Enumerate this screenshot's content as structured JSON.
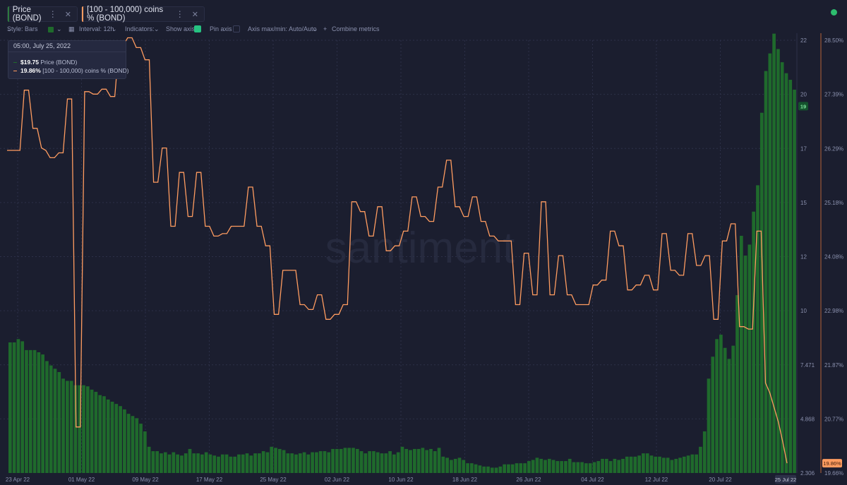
{
  "tabs": [
    {
      "label": "Price (BOND)",
      "color": "#2d7a3e"
    },
    {
      "label": "[100 - 100,000) coins % (BOND)",
      "color": "#ff9c60"
    }
  ],
  "toolbar": {
    "style": "Style: Bars",
    "interval": "Interval: 12h",
    "indicators": "Indicators:",
    "show_axis": "Show axis",
    "pin_axis": "Pin axis",
    "axis_minmax": "Axis max/min: Auto/Auto",
    "combine": "Combine metrics"
  },
  "tooltip": {
    "date": "05:00, July 25, 2022",
    "price_value": "$19.75",
    "price_label": "Price (BOND)",
    "holders_value": "19.86%",
    "holders_label": "[100 - 100,000) coins % (BOND)"
  },
  "watermark": "santiment",
  "colors": {
    "price": "#1f6a2c",
    "holders": "#ff9c60",
    "background": "#1b1e2f",
    "live": "#2dbd6e"
  },
  "chart_data": {
    "type": "bar",
    "x_ticks": [
      "23 Apr 22",
      "01 May 22",
      "09 May 22",
      "17 May 22",
      "25 May 22",
      "02 Jun 22",
      "10 Jun 22",
      "18 Jun 22",
      "26 Jun 22",
      "04 Jul 22",
      "12 Jul 22",
      "20 Jul 22"
    ],
    "last_x_label": "25 Jul 22",
    "price_axis": {
      "ticks": [
        "22",
        "20",
        "17",
        "15",
        "12",
        "10",
        "7.471",
        "4.868",
        "2.306"
      ],
      "ylim": [
        2.306,
        22
      ],
      "current_label": "19"
    },
    "holders_axis": {
      "ticks": [
        "28.50%",
        "27.39%",
        "26.29%",
        "25.18%",
        "24.08%",
        "22.98%",
        "21.87%",
        "20.77%",
        "19.66%"
      ],
      "ylim": [
        19.66,
        28.5
      ],
      "current_label": "19.86%"
    },
    "series": [
      {
        "name": "Price (BOND)",
        "type": "bar",
        "axis": "price",
        "values": [
          8.25,
          8.25,
          8.4,
          8.3,
          7.9,
          7.9,
          7.9,
          7.8,
          7.7,
          7.4,
          7.2,
          7.05,
          6.9,
          6.6,
          6.5,
          6.5,
          6.3,
          6.3,
          6.3,
          6.25,
          6.1,
          6.0,
          5.85,
          5.8,
          5.65,
          5.55,
          5.45,
          5.35,
          5.2,
          5.0,
          4.9,
          4.8,
          4.55,
          4.2,
          3.5,
          3.3,
          3.3,
          3.2,
          3.25,
          3.15,
          3.25,
          3.15,
          3.1,
          3.2,
          3.4,
          3.2,
          3.2,
          3.15,
          3.25,
          3.15,
          3.1,
          3.05,
          3.15,
          3.15,
          3.05,
          3.05,
          3.15,
          3.15,
          3.2,
          3.1,
          3.2,
          3.2,
          3.3,
          3.25,
          3.5,
          3.45,
          3.4,
          3.35,
          3.2,
          3.2,
          3.15,
          3.2,
          3.25,
          3.15,
          3.25,
          3.25,
          3.3,
          3.3,
          3.25,
          3.4,
          3.4,
          3.4,
          3.45,
          3.45,
          3.45,
          3.4,
          3.3,
          3.2,
          3.3,
          3.3,
          3.25,
          3.2,
          3.2,
          3.3,
          3.15,
          3.25,
          3.5,
          3.4,
          3.35,
          3.4,
          3.4,
          3.45,
          3.35,
          3.4,
          3.3,
          3.45,
          3.05,
          3.0,
          2.9,
          2.95,
          3.0,
          2.9,
          2.75,
          2.75,
          2.7,
          2.65,
          2.6,
          2.6,
          2.55,
          2.55,
          2.6,
          2.7,
          2.7,
          2.7,
          2.75,
          2.75,
          2.75,
          2.85,
          2.9,
          3.0,
          2.95,
          2.9,
          2.95,
          2.9,
          2.85,
          2.85,
          2.85,
          2.95,
          2.8,
          2.8,
          2.8,
          2.75,
          2.75,
          2.8,
          2.85,
          2.95,
          2.95,
          2.85,
          2.95,
          2.9,
          2.95,
          3.05,
          3.05,
          3.05,
          3.1,
          3.2,
          3.2,
          3.1,
          3.05,
          3.05,
          3.0,
          3.0,
          2.9,
          2.95,
          3.0,
          3.05,
          3.1,
          3.15,
          3.15,
          3.5,
          4.2,
          6.6,
          7.6,
          8.4,
          8.6,
          8.0,
          7.5,
          8.1,
          10.4,
          13.1,
          12.2,
          12.7,
          14.2,
          15.4,
          18.7,
          20.6,
          21.4,
          22.3,
          21.6,
          21.0,
          20.5,
          20.2,
          19.75
        ]
      },
      {
        "name": "[100 - 100,000) coins % (BOND)",
        "type": "line",
        "axis": "holders",
        "values": [
          26.25,
          26.25,
          26.25,
          26.25,
          27.48,
          27.48,
          26.7,
          26.7,
          26.3,
          26.25,
          26.1,
          26.1,
          26.2,
          26.2,
          27.3,
          27.3,
          20.6,
          20.6,
          27.45,
          27.45,
          27.4,
          27.4,
          27.5,
          27.5,
          27.35,
          27.35,
          28.4,
          28.4,
          28.55,
          28.55,
          28.35,
          28.35,
          28.1,
          28.1,
          25.6,
          25.6,
          26.3,
          26.3,
          24.7,
          24.7,
          25.8,
          25.8,
          24.9,
          24.9,
          25.8,
          25.8,
          24.7,
          24.7,
          24.5,
          24.5,
          24.55,
          24.55,
          24.7,
          24.7,
          24.7,
          24.7,
          25.5,
          25.5,
          24.7,
          24.7,
          24.3,
          24.3,
          22.9,
          22.9,
          23.8,
          23.8,
          23.8,
          23.8,
          23.1,
          23.1,
          23.0,
          23.0,
          23.3,
          23.3,
          22.8,
          22.8,
          22.9,
          22.9,
          23.1,
          23.1,
          25.2,
          25.2,
          25.0,
          25.0,
          24.5,
          24.5,
          25.1,
          25.1,
          24.2,
          24.2,
          24.3,
          24.3,
          24.6,
          24.6,
          25.3,
          25.3,
          24.9,
          24.9,
          24.8,
          24.8,
          25.5,
          25.5,
          26.05,
          26.05,
          25.1,
          25.1,
          24.9,
          24.9,
          25.3,
          25.3,
          24.8,
          24.8,
          24.5,
          24.5,
          24.4,
          24.4,
          24.4,
          24.4,
          23.1,
          23.1,
          24.15,
          24.15,
          23.3,
          23.3,
          25.2,
          25.2,
          23.3,
          23.3,
          24.1,
          24.1,
          23.3,
          23.3,
          23.1,
          23.1,
          23.1,
          23.1,
          23.5,
          23.5,
          23.6,
          23.6,
          24.6,
          24.6,
          24.3,
          24.3,
          23.4,
          23.4,
          23.5,
          23.5,
          23.7,
          23.7,
          23.4,
          23.4,
          24.55,
          24.55,
          23.8,
          23.8,
          23.7,
          23.7,
          24.55,
          24.55,
          23.9,
          23.9,
          24.1,
          24.1,
          22.8,
          22.8,
          24.4,
          24.4,
          24.75,
          24.75,
          22.65,
          22.65,
          22.6,
          22.6,
          24.6,
          24.6,
          21.5,
          21.3,
          21.0,
          20.7,
          20.3,
          19.86
        ]
      }
    ]
  }
}
